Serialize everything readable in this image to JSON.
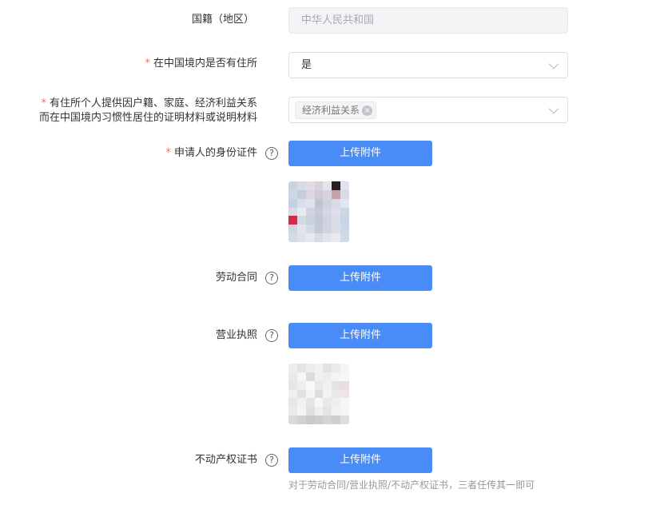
{
  "form": {
    "nationality": {
      "label": "国籍（地区）",
      "value": "中华人民共和国"
    },
    "domicile": {
      "required_mark": "*",
      "label": "在中国境内是否有住所",
      "value": "是"
    },
    "materials": {
      "required_mark": "*",
      "label_line1": "有住所个人提供因户籍、家庭、经济利益关系",
      "label_line2": "而在中国境内习惯性居住的证明材料或说明材料",
      "tag": "经济利益关系",
      "tag_close": "×"
    },
    "id_doc": {
      "required_mark": "*",
      "label": "申请人的身份证件",
      "help": "?",
      "button": "上传附件"
    },
    "labor_contract": {
      "label": "劳动合同",
      "help": "?",
      "button": "上传附件"
    },
    "business_license": {
      "label": "营业执照",
      "help": "?",
      "button": "上传附件"
    },
    "property_cert": {
      "label": "不动产权证书",
      "help": "?",
      "button": "上传附件"
    },
    "hint": "对于劳动合同/营业执照/不动产权证书，三者任传其一即可"
  },
  "thumbnails": {
    "id_doc": [
      "#c9d4e2",
      "#d6dbe6",
      "#e3dbe6",
      "#d8d2df",
      "#e6e2ea",
      "#2c1d24",
      "#dfe3ec",
      "#cdd8e6",
      "#c6ccda",
      "#dcd6e2",
      "#d4c8d6",
      "#d9d2de",
      "#c8a0ac",
      "#d6dbe6",
      "#c2d2e4",
      "#d9dde8",
      "#dfe2ea",
      "#b9c4d6",
      "#cfd3df",
      "#d8dbe5",
      "#e3e6ee",
      "#d9dce8",
      "#e8eaf1",
      "#d0d4e0",
      "#c6cad8",
      "#d3d7e2",
      "#dde0e9",
      "#cdd6e4",
      "#d7294a",
      "#d5d9e4",
      "#cbd0dd",
      "#c2c7d5",
      "#cfd3de",
      "#d9dde7",
      "#c6d4e6",
      "#cdd5e2",
      "#e2e5ec",
      "#d4d8e2",
      "#c4c9d7",
      "#d0d4df",
      "#dadde6",
      "#cad7e8",
      "#d5dbe6",
      "#dfe2ea",
      "#e6e8ee",
      "#d8dbe4",
      "#e2e4eb",
      "#e8eaf0",
      "#d0d9e6"
    ],
    "business_license": [
      "#eeeeee",
      "#e4e4e4",
      "#ececec",
      "#f2f2f2",
      "#e2e2e2",
      "#eaeaea",
      "#f4f4f4",
      "#e9e9e9",
      "#f6f6f6",
      "#dcdcdc",
      "#f1f1f1",
      "#eeeeee",
      "#f3f3f3",
      "#f7f7f7",
      "#e6e6e6",
      "#ededed",
      "#f8f8f8",
      "#e8e8e8",
      "#f0f0f0",
      "#e3e3e3",
      "#f0dcdc",
      "#efefef",
      "#e2e2e2",
      "#f5f5f5",
      "#dedede",
      "#f3f3f3",
      "#e8e8e8",
      "#f2e2e2",
      "#e7e7e7",
      "#f1f1f1",
      "#e5e5e5",
      "#f7f7f7",
      "#e9e9e9",
      "#eeeeee",
      "#f6f6f6",
      "#ebebeb",
      "#f4f4f4",
      "#dfdfdf",
      "#efefef",
      "#e4e4e4",
      "#f2f2f2",
      "#f5f5f5",
      "#d9d9d9",
      "#d2d2d2",
      "#c9c9c9",
      "#cecece",
      "#d4d4d4",
      "#cfcfcf",
      "#dddddd"
    ]
  }
}
